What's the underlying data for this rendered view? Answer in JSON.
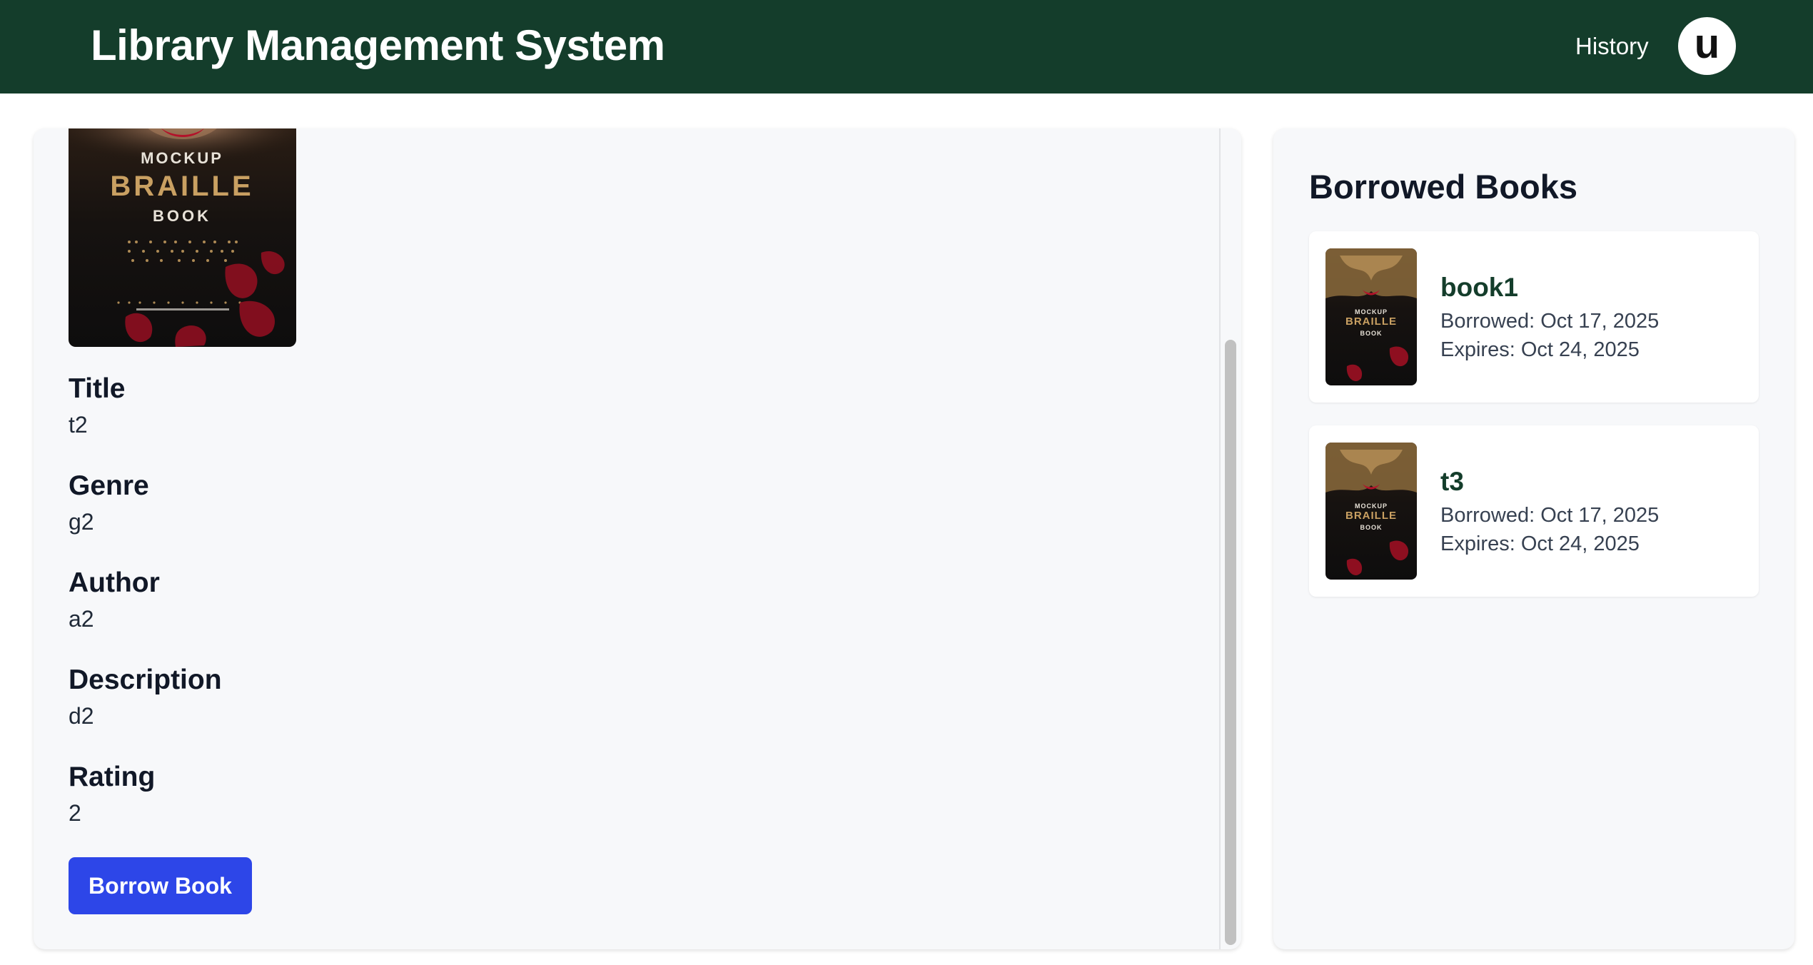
{
  "header": {
    "title": "Library Management System",
    "history_label": "History",
    "avatar_initial": "u"
  },
  "book": {
    "cover_text": {
      "line1": "MOCKUP",
      "line2": "BRAILLE",
      "line3": "BOOK"
    },
    "fields": [
      {
        "label": "Title",
        "value": "t2"
      },
      {
        "label": "Genre",
        "value": "g2"
      },
      {
        "label": "Author",
        "value": "a2"
      },
      {
        "label": "Description",
        "value": "d2"
      },
      {
        "label": "Rating",
        "value": "2"
      }
    ],
    "borrow_label": "Borrow Book"
  },
  "borrowed": {
    "title": "Borrowed Books",
    "items": [
      {
        "title": "book1",
        "borrowed": "Borrowed: Oct 17, 2025",
        "expires": "Expires: Oct 24, 2025"
      },
      {
        "title": "t3",
        "borrowed": "Borrowed: Oct 17, 2025",
        "expires": "Expires: Oct 24, 2025"
      }
    ]
  },
  "colors": {
    "header_bg": "#143d2b",
    "button_bg": "#2d46e8",
    "panel_bg": "#f7f8fa"
  }
}
